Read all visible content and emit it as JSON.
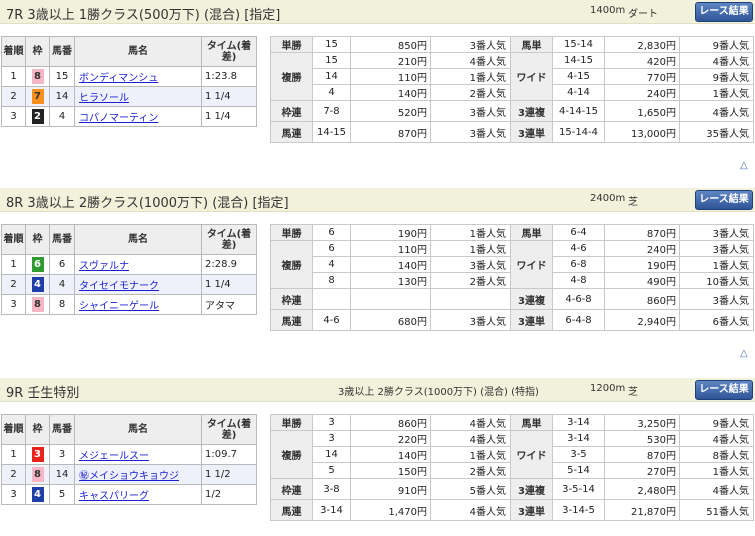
{
  "colors": {
    "waku1": "#ffffff",
    "waku2": "#222222",
    "waku3": "#e8231b",
    "waku4": "#1f3ea8",
    "waku5": "#f2d51a",
    "waku6": "#2f9a2f",
    "waku7": "#f58f1e",
    "waku8": "#f6b6c6"
  },
  "races": [
    {
      "title": "7R 3歳以上 1勝クラス(500万下) (混合) [指定]",
      "cond": "",
      "dist": "1400m",
      "surf": "ダート",
      "btn": "レース結果",
      "hdr": {
        "rank": "着順",
        "waku": "枠",
        "num": "馬番",
        "name": "馬名",
        "time": "タイム(着差)"
      },
      "horses": [
        {
          "rank": "1",
          "waku": "8",
          "wakuN": 8,
          "num": "15",
          "name": "ボンディマンシュ",
          "time": "1:23.8"
        },
        {
          "rank": "2",
          "waku": "7",
          "wakuN": 7,
          "num": "14",
          "name": "ヒラソール",
          "time": "1 1/4"
        },
        {
          "rank": "3",
          "waku": "2",
          "wakuN": 2,
          "num": "4",
          "name": "コパノマーティン",
          "time": "1 1/4"
        }
      ],
      "pay": {
        "tansho": {
          "label": "単勝",
          "num": "15",
          "yen": "850円",
          "pop": "3番人気"
        },
        "fukusho": {
          "label": "複勝",
          "rows": [
            {
              "num": "15",
              "yen": "210円",
              "pop": "4番人気"
            },
            {
              "num": "14",
              "yen": "110円",
              "pop": "1番人気"
            },
            {
              "num": "4",
              "yen": "140円",
              "pop": "2番人気"
            }
          ]
        },
        "wakuren": {
          "label": "枠連",
          "num": "7-8",
          "yen": "520円",
          "pop": "3番人気"
        },
        "umaren": {
          "label": "馬連",
          "num": "14-15",
          "yen": "870円",
          "pop": "3番人気"
        },
        "umatan": {
          "label": "馬単",
          "num": "15-14",
          "yen": "2,830円",
          "pop": "9番人気"
        },
        "wide": {
          "label": "ワイド",
          "rows": [
            {
              "num": "14-15",
              "yen": "420円",
              "pop": "4番人気"
            },
            {
              "num": "4-15",
              "yen": "770円",
              "pop": "9番人気"
            },
            {
              "num": "4-14",
              "yen": "240円",
              "pop": "1番人気"
            }
          ]
        },
        "sanrenpuku": {
          "label": "3連複",
          "num": "4-14-15",
          "yen": "1,650円",
          "pop": "4番人気"
        },
        "sanrentan": {
          "label": "3連単",
          "num": "15-14-4",
          "yen": "13,000円",
          "pop": "35番人気"
        }
      }
    },
    {
      "title": "8R 3歳以上 2勝クラス(1000万下) (混合) [指定]",
      "cond": "",
      "dist": "2400m",
      "surf": "芝",
      "btn": "レース結果",
      "hdr": {
        "rank": "着順",
        "waku": "枠",
        "num": "馬番",
        "name": "馬名",
        "time": "タイム(着差)"
      },
      "horses": [
        {
          "rank": "1",
          "waku": "6",
          "wakuN": 6,
          "num": "6",
          "name": "スヴァルナ",
          "time": "2:28.9"
        },
        {
          "rank": "2",
          "waku": "4",
          "wakuN": 4,
          "num": "4",
          "name": "タイセイモナーク",
          "time": "1 1/4"
        },
        {
          "rank": "3",
          "waku": "8",
          "wakuN": 8,
          "num": "8",
          "name": "シャイニーゲール",
          "time": "アタマ"
        }
      ],
      "pay": {
        "tansho": {
          "label": "単勝",
          "num": "6",
          "yen": "190円",
          "pop": "1番人気"
        },
        "fukusho": {
          "label": "複勝",
          "rows": [
            {
              "num": "6",
              "yen": "110円",
              "pop": "1番人気"
            },
            {
              "num": "4",
              "yen": "140円",
              "pop": "3番人気"
            },
            {
              "num": "8",
              "yen": "130円",
              "pop": "2番人気"
            }
          ]
        },
        "wakuren": {
          "label": "枠連",
          "num": "",
          "yen": "",
          "pop": ""
        },
        "umaren": {
          "label": "馬連",
          "num": "4-6",
          "yen": "680円",
          "pop": "3番人気"
        },
        "umatan": {
          "label": "馬単",
          "num": "6-4",
          "yen": "870円",
          "pop": "3番人気"
        },
        "wide": {
          "label": "ワイド",
          "rows": [
            {
              "num": "4-6",
              "yen": "240円",
              "pop": "3番人気"
            },
            {
              "num": "6-8",
              "yen": "190円",
              "pop": "1番人気"
            },
            {
              "num": "4-8",
              "yen": "490円",
              "pop": "10番人気"
            }
          ]
        },
        "sanrenpuku": {
          "label": "3連複",
          "num": "4-6-8",
          "yen": "860円",
          "pop": "3番人気"
        },
        "sanrentan": {
          "label": "3連単",
          "num": "6-4-8",
          "yen": "2,940円",
          "pop": "6番人気"
        }
      }
    },
    {
      "title": "9R 壬生特別",
      "cond": "3歳以上 2勝クラス(1000万下) (混合) (特指)",
      "dist": "1200m",
      "surf": "芝",
      "btn": "レース結果",
      "hdr": {
        "rank": "着順",
        "waku": "枠",
        "num": "馬番",
        "name": "馬名",
        "time": "タイム(着差)"
      },
      "horses": [
        {
          "rank": "1",
          "waku": "3",
          "wakuN": 3,
          "num": "3",
          "name": "メジェールスー",
          "time": "1:09.7"
        },
        {
          "rank": "2",
          "waku": "8",
          "wakuN": 8,
          "num": "14",
          "name": "㊙メイショウキョウジ",
          "time": "1 1/2"
        },
        {
          "rank": "3",
          "waku": "4",
          "wakuN": 4,
          "num": "5",
          "name": "キャスパリーグ",
          "time": "1/2"
        }
      ],
      "pay": {
        "tansho": {
          "label": "単勝",
          "num": "3",
          "yen": "860円",
          "pop": "4番人気"
        },
        "fukusho": {
          "label": "複勝",
          "rows": [
            {
              "num": "3",
              "yen": "220円",
              "pop": "4番人気"
            },
            {
              "num": "14",
              "yen": "140円",
              "pop": "1番人気"
            },
            {
              "num": "5",
              "yen": "150円",
              "pop": "2番人気"
            }
          ]
        },
        "wakuren": {
          "label": "枠連",
          "num": "3-8",
          "yen": "910円",
          "pop": "5番人気"
        },
        "umaren": {
          "label": "馬連",
          "num": "3-14",
          "yen": "1,470円",
          "pop": "4番人気"
        },
        "umatan": {
          "label": "馬単",
          "num": "3-14",
          "yen": "3,250円",
          "pop": "9番人気"
        },
        "wide": {
          "label": "ワイド",
          "rows": [
            {
              "num": "3-14",
              "yen": "530円",
              "pop": "4番人気"
            },
            {
              "num": "3-5",
              "yen": "870円",
              "pop": "8番人気"
            },
            {
              "num": "5-14",
              "yen": "270円",
              "pop": "1番人気"
            }
          ]
        },
        "sanrenpuku": {
          "label": "3連複",
          "num": "3-5-14",
          "yen": "2,480円",
          "pop": "4番人気"
        },
        "sanrentan": {
          "label": "3連単",
          "num": "3-14-5",
          "yen": "21,870円",
          "pop": "51番人気"
        }
      }
    }
  ]
}
